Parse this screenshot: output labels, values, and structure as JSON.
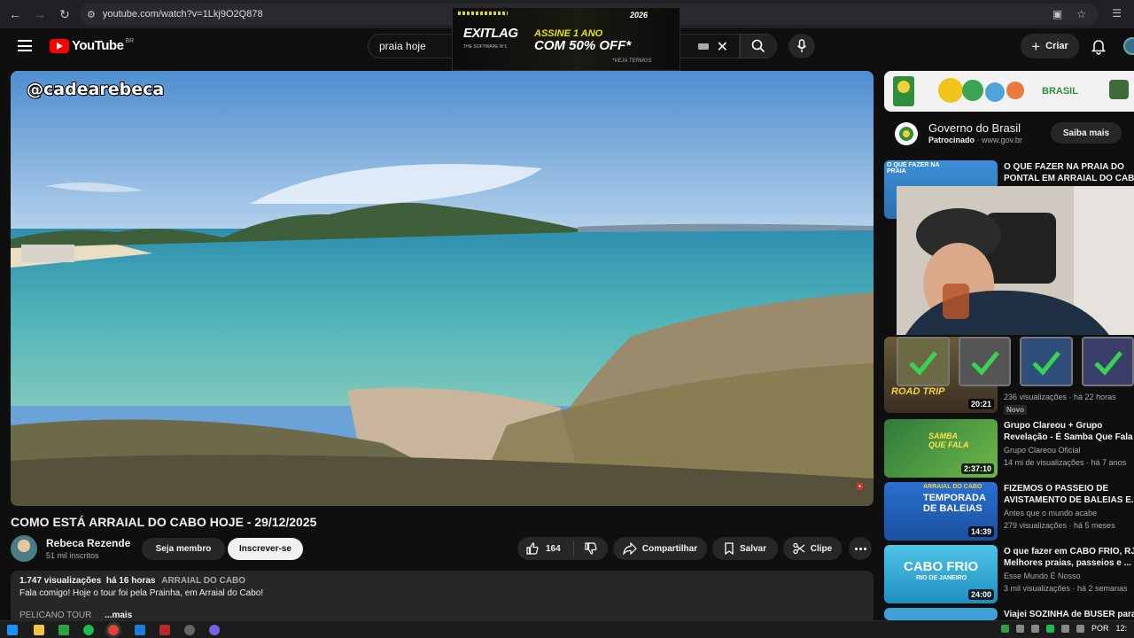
{
  "browser": {
    "url": "youtube.com/watch?v=1Lkj9O2Q878"
  },
  "masthead": {
    "logo_text": "YouTube",
    "country_code": "BR",
    "search_value": "praia hoje",
    "create_label": "Criar"
  },
  "top_ad": {
    "brand": "EXITLAG",
    "brand_sub": "THE SOFTWARE Nº1",
    "line1": "ASSINE 1 ANO",
    "line2": "COM 50% OFF*",
    "terms": "*VEJA TERMOS",
    "year": "2026"
  },
  "player": {
    "watermark": "@cadearebeca"
  },
  "video": {
    "title": "COMO ESTÁ ARRAIAL DO CABO HOJE - 29/12/2025",
    "channel_name": "Rebeca Rezende",
    "subscribers": "51 mil inscritos",
    "member_label": "Seja membro",
    "subscribe_label": "Inscrever-se",
    "likes": "164",
    "share_label": "Compartilhar",
    "save_label": "Salvar",
    "clip_label": "Clipe"
  },
  "description": {
    "views": "1.747 visualizações",
    "age": "há 16 horas",
    "tag": "ARRAIAL DO CABO",
    "text": "Fala comigo! Hoje o tour foi pela Prainha, em Arraial do Cabo!",
    "snippet": "PELICANO TOUR",
    "more_label": "...mais"
  },
  "sponsored": {
    "advertiser": "Governo do Brasil",
    "label": "Patrocinado",
    "domain": "www.gov.br",
    "cta": "Saiba mais"
  },
  "recommendations": [
    {
      "title_line1": "O QUE FAZER NA PRAIA DO",
      "title_line2": "PONTAL EM ARRAIAL DO CAB",
      "thumb_text": "O QUE FAZER NA PRAIA"
    },
    {
      "duration": "20:21",
      "stats": "236 visualizações · há 22 horas",
      "badge": "Novo",
      "thumb_text": "ROAD TRIP"
    },
    {
      "title_line1": "Grupo Clareou + Grupo",
      "title_line2": "Revelação - É Samba Que Fala",
      "channel": "Grupo Clareou Oficial",
      "stats": "14 mi de visualizações · há 7 anos",
      "duration": "2:37:10",
      "thumb_text": "SAMBA QUE FALA"
    },
    {
      "title_line1": "FIZEMOS O PASSEIO DE",
      "title_line2": "AVISTAMENTO DE BALEIAS E...",
      "channel": "Antes que o mundo acabe",
      "stats": "279 visualizações · há 5 meses",
      "duration": "14:39",
      "thumb_text_top": "ARRAIAL DO CABO",
      "thumb_text": "TEMPORADA DE BALEIAS"
    },
    {
      "title_line1": "O que fazer em CABO FRIO, RJ",
      "title_line2": "Melhores praias, passeios e ...",
      "channel": "Esse Mundo É Nosso",
      "stats": "3 mil visualizações · há 2 semanas",
      "duration": "24:00",
      "thumb_text": "CABO FRIO",
      "thumb_sub": "RIO DE JANEIRO"
    },
    {
      "title_line1": "Viajei SOZINHA de BUSER para"
    }
  ],
  "taskbar": {
    "language": "POR",
    "time": "12:"
  }
}
